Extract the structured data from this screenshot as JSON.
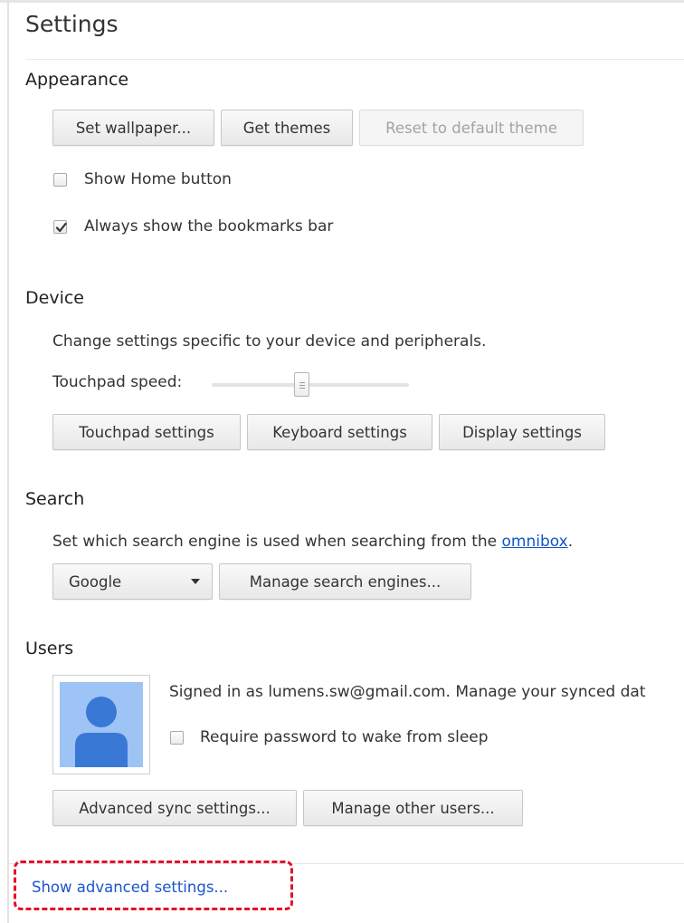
{
  "page": {
    "title": "Settings"
  },
  "appearance": {
    "heading": "Appearance",
    "set_wallpaper_label": "Set wallpaper...",
    "get_themes_label": "Get themes",
    "reset_theme_label": "Reset to default theme",
    "show_home_label": "Show Home button",
    "show_home_checked": false,
    "bookmarks_bar_label": "Always show the bookmarks bar",
    "bookmarks_bar_checked": true
  },
  "device": {
    "heading": "Device",
    "description": "Change settings specific to your device and peripherals.",
    "touchpad_speed_label": "Touchpad speed:",
    "touchpad_speed_value": 0.5,
    "touchpad_settings_label": "Touchpad settings",
    "keyboard_settings_label": "Keyboard settings",
    "display_settings_label": "Display settings"
  },
  "search": {
    "heading": "Search",
    "description_prefix": "Set which search engine is used when searching from the ",
    "omnibox_link": "omnibox",
    "description_suffix": ".",
    "engine_selected": "Google",
    "manage_engines_label": "Manage search engines..."
  },
  "users": {
    "heading": "Users",
    "signed_in_text": "Signed in as lumens.sw@gmail.com. Manage your synced dat",
    "require_password_label": "Require password to wake from sleep",
    "require_password_checked": false,
    "advanced_sync_label": "Advanced sync settings...",
    "manage_users_label": "Manage other users..."
  },
  "footer": {
    "show_advanced_label": "Show advanced settings..."
  },
  "colors": {
    "link": "#1155cc",
    "highlight_dash": "#e3122a",
    "avatar_bg": "#9ec3f5",
    "avatar_figure": "#3a78d6"
  }
}
